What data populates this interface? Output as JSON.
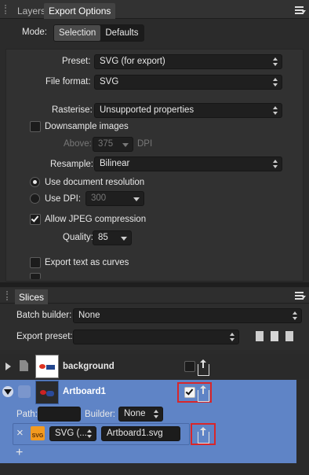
{
  "tabs": [
    {
      "label": "Layers"
    },
    {
      "label": "Export Options"
    }
  ],
  "icons": {
    "panel_menu": "hamburger-menu-icon",
    "grip": "panel-grip-icon"
  },
  "export_options": {
    "mode_label": "Mode:",
    "mode_options": [
      "Selection",
      "Defaults"
    ],
    "mode_selected": "Selection",
    "preset_label": "Preset:",
    "preset_value": "SVG (for export)",
    "file_format_label": "File format:",
    "file_format_value": "SVG",
    "rasterise_label": "Rasterise:",
    "rasterise_value": "Unsupported properties",
    "downsample_label": "Downsample images",
    "downsample_checked": false,
    "above_label": "Above:",
    "above_value": "375",
    "above_unit": "DPI",
    "resample_label": "Resample:",
    "resample_value": "Bilinear",
    "use_doc_res_label": "Use document resolution",
    "use_doc_res_selected": true,
    "use_dpi_label": "Use DPI:",
    "use_dpi_value": "300",
    "allow_jpeg_label": "Allow JPEG compression",
    "allow_jpeg_checked": true,
    "quality_label": "Quality:",
    "quality_value": "85",
    "text_curves_label": "Export text as curves",
    "text_curves_checked": false
  },
  "slices": {
    "tab_label": "Slices",
    "batch_builder_label": "Batch builder:",
    "batch_builder_value": "None",
    "export_preset_label": "Export preset:",
    "export_preset_value": "",
    "items": [
      {
        "name": "background",
        "checked": false
      },
      {
        "name": "Artboard1",
        "checked": true
      }
    ],
    "path_label": "Path:",
    "path_value": "",
    "builder_label": "Builder:",
    "builder_value": "None",
    "format_value": "SVG (...",
    "filename_value": "Artboard1.svg",
    "svg_badge_text": "SVG",
    "add_symbol": "+",
    "remove_symbol": "×"
  },
  "colors": {
    "selection": "#5f84c6",
    "highlight": "#d8262a",
    "svg_badge": "#f39a1f"
  }
}
